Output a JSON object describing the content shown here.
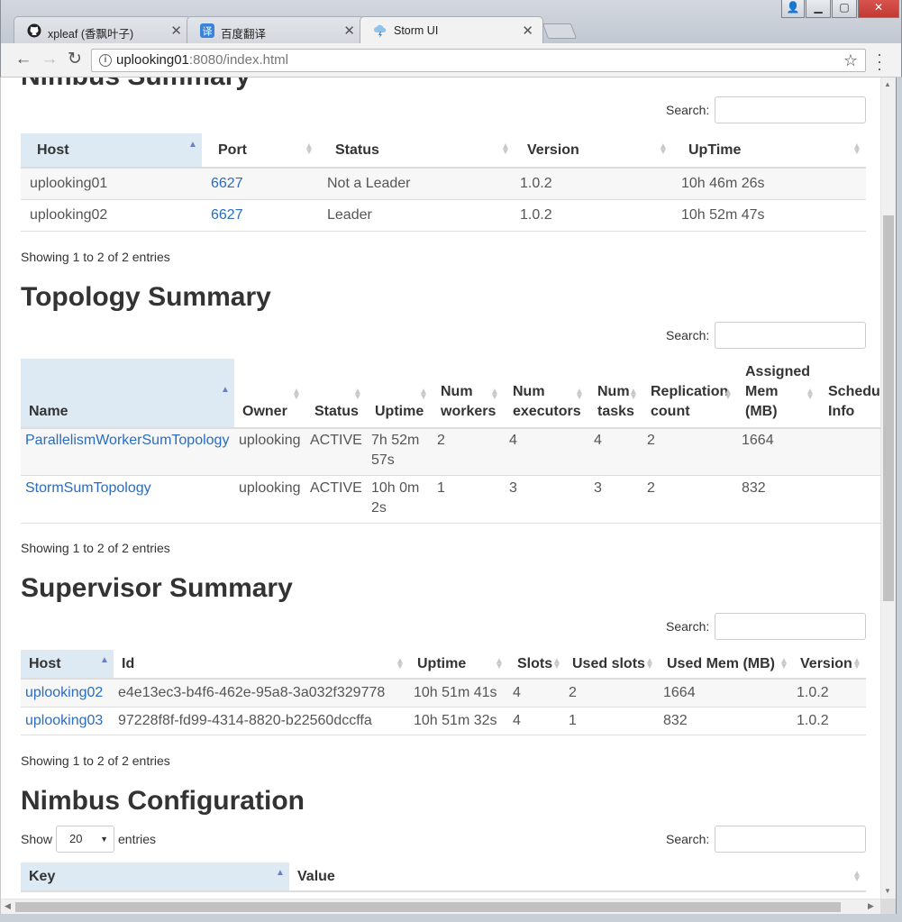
{
  "browser": {
    "tabs": [
      {
        "title": "xpleaf (香飘叶子)",
        "icon": "github-icon"
      },
      {
        "title": "百度翻译",
        "icon": "baidu-translate-icon"
      },
      {
        "title": "Storm UI",
        "icon": "storm-icon"
      }
    ],
    "url_host": "uplooking01",
    "url_rest": ":8080/index.html"
  },
  "nimbus_summary": {
    "title": "Nimbus Summary",
    "search_label": "Search:",
    "columns": [
      "Host",
      "Port",
      "Status",
      "Version",
      "UpTime"
    ],
    "rows": [
      [
        "uplooking01",
        "6627",
        "Not a Leader",
        "1.0.2",
        "10h 46m 26s"
      ],
      [
        "uplooking02",
        "6627",
        "Leader",
        "1.0.2",
        "10h 52m 47s"
      ]
    ],
    "showing": "Showing 1 to 2 of 2 entries"
  },
  "topology_summary": {
    "title": "Topology Summary",
    "search_label": "Search:",
    "columns": [
      "Name",
      "Owner",
      "Status",
      "Uptime",
      "Num workers",
      "Num executors",
      "Num tasks",
      "Replication count",
      "Assigned Mem (MB)",
      "Scheduler Info"
    ],
    "col_lines": {
      "uptime": [
        "Uptime"
      ],
      "workers": [
        "Num",
        "workers"
      ],
      "executors": [
        "Num",
        "executors"
      ],
      "tasks": [
        "Num",
        "tasks"
      ],
      "replication": [
        "Replication",
        "count"
      ],
      "mem": [
        "Assigned",
        "Mem",
        "(MB)"
      ],
      "sched": [
        "Schedu",
        "Info"
      ]
    },
    "rows": [
      {
        "name": "ParallelismWorkerSumTopology",
        "owner": "uplooking",
        "status": "ACTIVE",
        "uptime1": "7h 52m",
        "uptime2": "57s",
        "workers": "2",
        "executors": "4",
        "tasks": "4",
        "replication": "2",
        "mem": "1664"
      },
      {
        "name": "StormSumTopology",
        "owner": "uplooking",
        "status": "ACTIVE",
        "uptime1": "10h 0m",
        "uptime2": "2s",
        "workers": "1",
        "executors": "3",
        "tasks": "3",
        "replication": "2",
        "mem": "832"
      }
    ],
    "showing": "Showing 1 to 2 of 2 entries"
  },
  "supervisor_summary": {
    "title": "Supervisor Summary",
    "search_label": "Search:",
    "columns": [
      "Host",
      "Id",
      "Uptime",
      "Slots",
      "Used slots",
      "Used Mem (MB)",
      "Version"
    ],
    "rows": [
      [
        "uplooking02",
        "e4e13ec3-b4f6-462e-95a8-3a032f329778",
        "10h 51m 41s",
        "4",
        "2",
        "1664",
        "1.0.2"
      ],
      [
        "uplooking03",
        "97228f8f-fd99-4314-8820-b22560dccffa",
        "10h 51m 32s",
        "4",
        "1",
        "832",
        "1.0.2"
      ]
    ],
    "showing": "Showing 1 to 2 of 2 entries"
  },
  "nimbus_configuration": {
    "title": "Nimbus Configuration",
    "show_label": "Show",
    "entries_value": "20",
    "entries_label": "entries",
    "search_label": "Search:",
    "columns": [
      "Key",
      "Value"
    ]
  },
  "colors": {
    "link": "#2a6cbf",
    "sorted_header": "#dde9f3",
    "heading": "#333333"
  }
}
